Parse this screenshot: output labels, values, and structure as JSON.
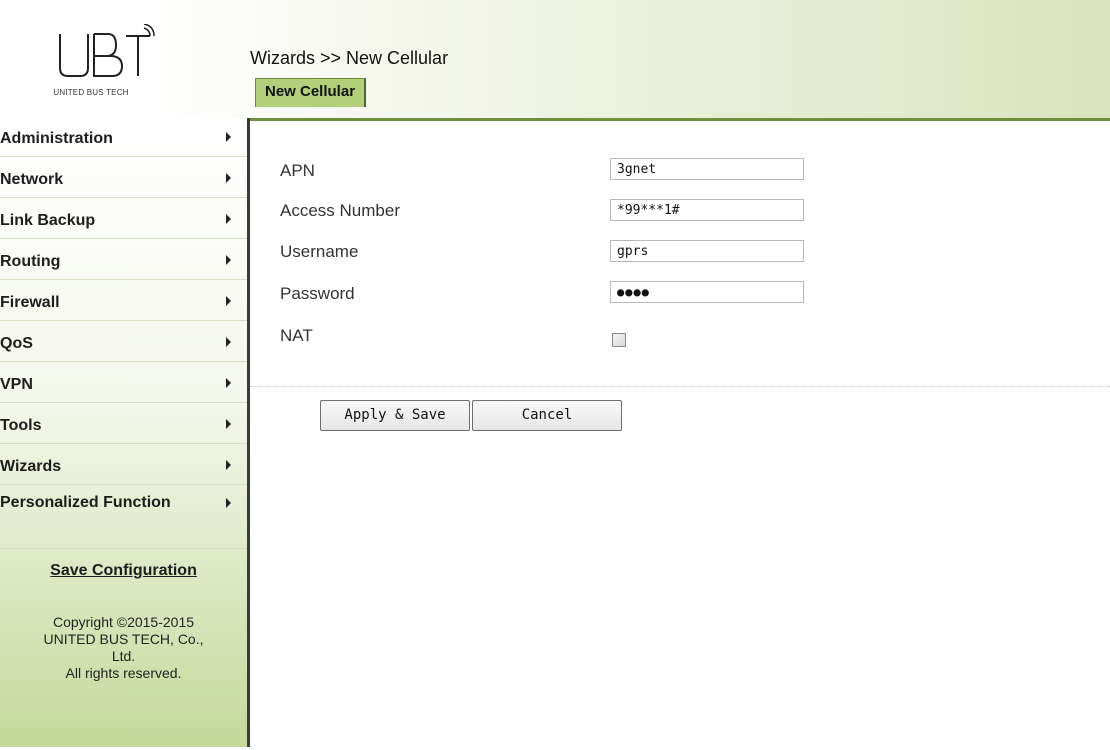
{
  "brand": {
    "logo_text": "UBT",
    "company": "UNITED BUS TECH"
  },
  "header": {
    "title": "Wizards >> New Cellular",
    "tab_label": "New Cellular"
  },
  "sidebar": {
    "items": [
      {
        "label": "Administration"
      },
      {
        "label": "Network"
      },
      {
        "label": "Link Backup"
      },
      {
        "label": "Routing"
      },
      {
        "label": "Firewall"
      },
      {
        "label": "QoS"
      },
      {
        "label": "VPN"
      },
      {
        "label": "Tools"
      },
      {
        "label": "Wizards"
      },
      {
        "label": "Personalized Function"
      }
    ],
    "save_link": "Save Configuration",
    "copyright": {
      "line1": "Copyright ©2015-2015",
      "line2": "UNITED BUS TECH, Co.,",
      "line3": "Ltd.",
      "line4": "All rights reserved."
    }
  },
  "form": {
    "apn": {
      "label": "APN",
      "value": "3gnet"
    },
    "access_number": {
      "label": "Access Number",
      "value": "*99***1#"
    },
    "username": {
      "label": "Username",
      "value": "gprs"
    },
    "password": {
      "label": "Password",
      "value": "●●●●"
    },
    "nat": {
      "label": "NAT",
      "checked": false
    }
  },
  "buttons": {
    "apply_save": "Apply & Save",
    "cancel": "Cancel"
  },
  "colors": {
    "accent": "#b3cf7a",
    "tab_border": "#6a8a36",
    "divider": "#3b3b3b"
  },
  "icons": [
    "ubt-logo-icon",
    "submenu-arrow-icon",
    "checkbox-unchecked-icon"
  ]
}
